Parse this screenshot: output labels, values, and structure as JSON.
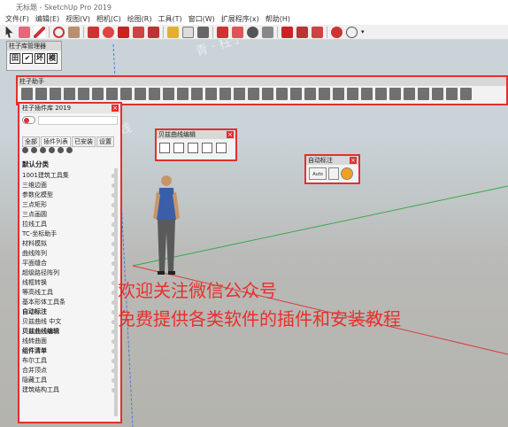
{
  "window": {
    "title": "无标题 - SketchUp Pro 2019"
  },
  "menu": [
    "文件(F)",
    "编辑(E)",
    "视图(V)",
    "相机(C)",
    "绘图(R)",
    "工具(T)",
    "窗口(W)",
    "扩展程序(x)",
    "帮助(H)"
  ],
  "plugin_manager": {
    "title": "柱子库管理器",
    "buttons": [
      "田",
      "✔",
      "坏",
      "模"
    ]
  },
  "helper_toolbar": {
    "title": "柱子助手"
  },
  "library": {
    "title": "柱子插件库 2019",
    "search_value": "",
    "tabs": [
      "全部",
      "插件列表",
      "已安装",
      "设置"
    ],
    "active_tab": 1,
    "category": "默认分类",
    "items": [
      {
        "label": "1001建筑工具集",
        "bold": false
      },
      {
        "label": "三维边面",
        "bold": false
      },
      {
        "label": "参数化模型",
        "bold": false
      },
      {
        "label": "三点矩形",
        "bold": false
      },
      {
        "label": "三点画圆",
        "bold": false
      },
      {
        "label": "拉线工具",
        "bold": false
      },
      {
        "label": "TC-坐标助手",
        "bold": false
      },
      {
        "label": "材料模拟",
        "bold": false
      },
      {
        "label": "曲线阵列",
        "bold": false
      },
      {
        "label": "平面缝合",
        "bold": false
      },
      {
        "label": "超级路径阵列",
        "bold": false
      },
      {
        "label": "线框转换",
        "bold": false
      },
      {
        "label": "等高线工具",
        "bold": false
      },
      {
        "label": "基本形体工具条",
        "bold": false
      },
      {
        "label": "自动标注",
        "bold": true
      },
      {
        "label": "贝兹曲线 中文",
        "bold": false
      },
      {
        "label": "贝兹曲线编辑",
        "bold": true
      },
      {
        "label": "线转曲面",
        "bold": false
      },
      {
        "label": "组件清单",
        "bold": true
      },
      {
        "label": "布尔工具",
        "bold": false
      },
      {
        "label": "合并顶点",
        "bold": false
      },
      {
        "label": "隐藏工具",
        "bold": false
      },
      {
        "label": "建筑结构工具",
        "bold": false
      }
    ]
  },
  "bezier_panel": {
    "title": "贝兹曲线编辑"
  },
  "auto_label_panel": {
    "title": "自动标注",
    "buttons": [
      "Auto",
      "",
      ""
    ]
  },
  "overlay": {
    "line1": "欢迎关注微信公众号",
    "line2": "免费提供各类软件的插件和安装教程"
  },
  "colors": {
    "highlight": "#e13030",
    "overlay_text": "#e8302c"
  }
}
